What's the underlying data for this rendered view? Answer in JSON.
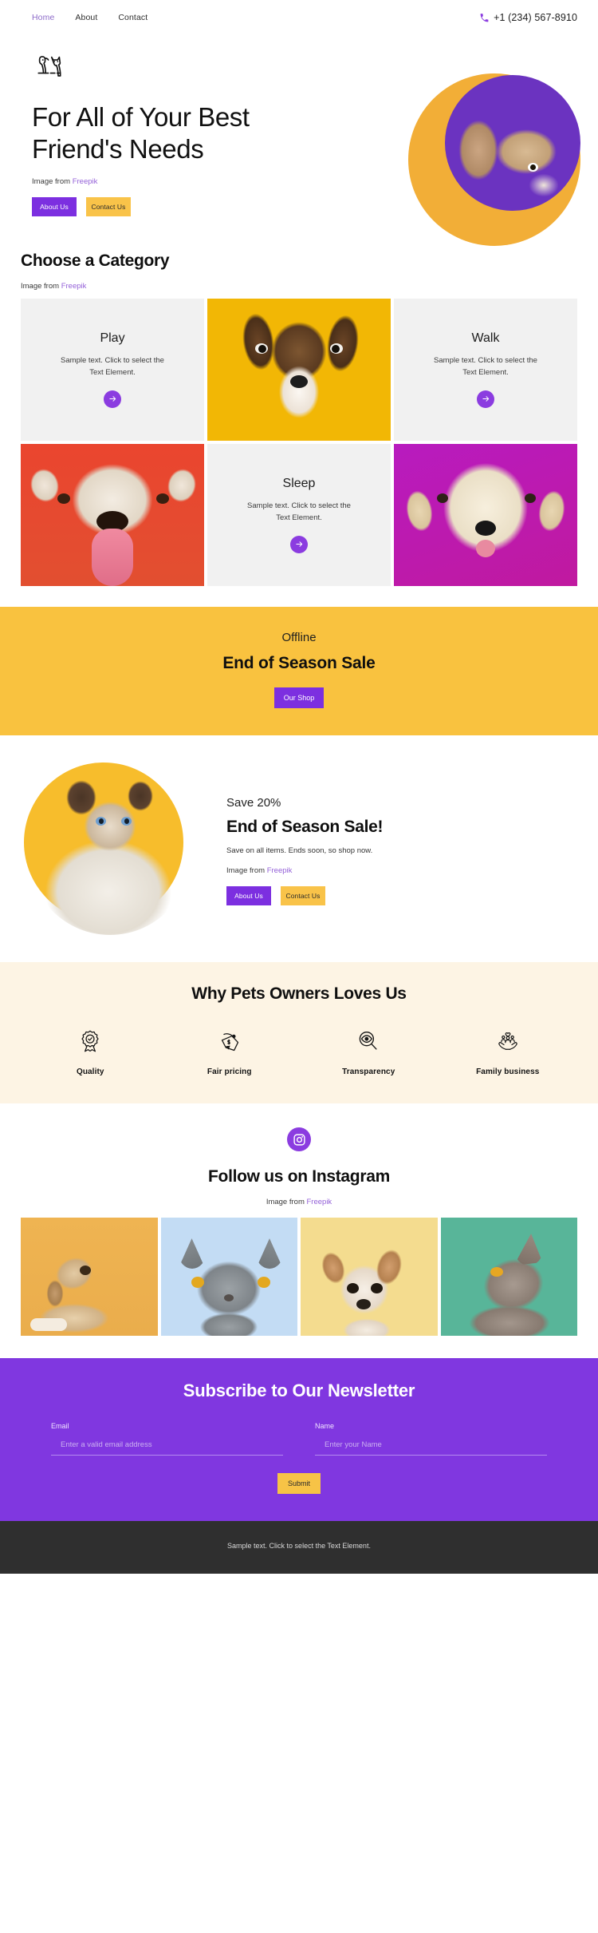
{
  "header": {
    "nav": [
      {
        "label": "Home",
        "active": true
      },
      {
        "label": "About",
        "active": false
      },
      {
        "label": "Contact",
        "active": false
      }
    ],
    "phone": "+1 (234) 567-8910",
    "phone_icon": "phone-icon"
  },
  "hero": {
    "logo_icon": "dog-cat-logo-icon",
    "title": "For All of Your Best Friend's Needs",
    "credit_prefix": "Image from ",
    "credit_link": "Freepik",
    "buttons": [
      {
        "label": "About Us",
        "style": "purple"
      },
      {
        "label": "Contact Us",
        "style": "amber"
      }
    ],
    "art": {
      "circle_back": "#f2ae37",
      "circle_front": "#6b33c0",
      "subject": "french-bulldog-photo"
    }
  },
  "category": {
    "heading": "Choose a Category",
    "credit_prefix": "Image from ",
    "credit_link": "Freepik",
    "cells": [
      {
        "kind": "text",
        "title": "Play",
        "body": "Sample text. Click to select the Text Element.",
        "arrow": "arrow-right-icon"
      },
      {
        "kind": "photo",
        "name": "beagle-puppy-photo",
        "bg": "#f2b705"
      },
      {
        "kind": "text",
        "title": "Walk",
        "body": "Sample text. Click to select the Text Element.",
        "arrow": "arrow-right-icon"
      },
      {
        "kind": "photo",
        "name": "bulldog-photo",
        "bg": "#e8472f"
      },
      {
        "kind": "text",
        "title": "Sleep",
        "body": "Sample text. Click to select the Text Element.",
        "arrow": "arrow-right-icon"
      },
      {
        "kind": "photo",
        "name": "golden-retriever-photo",
        "bg": "#bc1ab4"
      }
    ]
  },
  "sale_banner": {
    "kicker": "Offline",
    "title": "End of Season Sale",
    "button": "Our Shop",
    "bg": "#f9c23f"
  },
  "save": {
    "kicker": "Save 20%",
    "title": "End of Season Sale!",
    "desc": "Save on all items. Ends soon, so shop now.",
    "credit_prefix": "Image from ",
    "credit_link": "Freepik",
    "buttons": [
      {
        "label": "About Us",
        "style": "purple"
      },
      {
        "label": "Contact Us",
        "style": "amber"
      }
    ],
    "art": {
      "name": "siamese-cat-photo",
      "circle": "#f7bd2c"
    }
  },
  "why": {
    "heading": "Why Pets Owners Loves Us",
    "bg": "#fdf4e4",
    "items": [
      {
        "icon": "award-badge-icon",
        "label": "Quality"
      },
      {
        "icon": "price-tag-icon",
        "label": "Fair pricing"
      },
      {
        "icon": "magnifier-eye-icon",
        "label": "Transparency"
      },
      {
        "icon": "hands-family-heart-icon",
        "label": "Family business"
      }
    ]
  },
  "instagram": {
    "badge_icon": "instagram-icon",
    "title": "Follow us on Instagram",
    "credit_prefix": "Image from ",
    "credit_link": "Freepik",
    "photos": [
      {
        "name": "howling-dog-photo",
        "bg": "#efb452"
      },
      {
        "name": "gray-cat-photo",
        "bg": "#c3dcf4"
      },
      {
        "name": "chihuahua-photo",
        "bg": "#f4dc8f"
      },
      {
        "name": "looking-up-cat-photo",
        "bg": "#58b599"
      }
    ]
  },
  "newsletter": {
    "title": "Subscribe to Our Newsletter",
    "bg": "#8037e0",
    "email_label": "Email",
    "email_placeholder": "Enter a valid email address",
    "email_value": "",
    "name_label": "Name",
    "name_placeholder": "Enter your Name",
    "name_value": "",
    "submit_label": "Submit"
  },
  "footer": {
    "text": "Sample text. Click to select the Text Element.",
    "bg": "#2f2f2f"
  },
  "colors": {
    "purple": "#7c2fe0",
    "amber": "#f9c349",
    "link": "#9461d8"
  }
}
